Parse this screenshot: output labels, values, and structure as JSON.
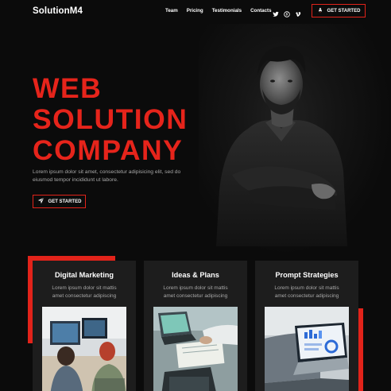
{
  "brand": "SolutionM4",
  "nav": {
    "items": [
      "Team",
      "Pricing",
      "Testimonials",
      "Contacts"
    ],
    "cta": "GET STARTED",
    "social": [
      "twitter-icon",
      "skype-icon",
      "vimeo-icon"
    ]
  },
  "hero": {
    "headline": [
      "WEB",
      "SOLUTION",
      "COMPANY"
    ],
    "text": "Lorem ipsum dolor sit amet, consectetur adipisicing elit, sed do eiusmod tempor incididunt ut labore.",
    "cta": "GET STARTED"
  },
  "cards": [
    {
      "title": "Digital Marketing",
      "text": "Lorem ipsum dolor sit mattis amet consectetur adipiscing"
    },
    {
      "title": "Ideas & Plans",
      "text": "Lorem ipsum dolor sit mattis amet consectetur adipiscing"
    },
    {
      "title": "Prompt Strategies",
      "text": "Lorem ipsum dolor sit mattis amet consectetur adipiscing"
    }
  ],
  "colors": {
    "accent": "#e2231a",
    "background": "#0b0b0b",
    "card": "#1d1d1d"
  }
}
